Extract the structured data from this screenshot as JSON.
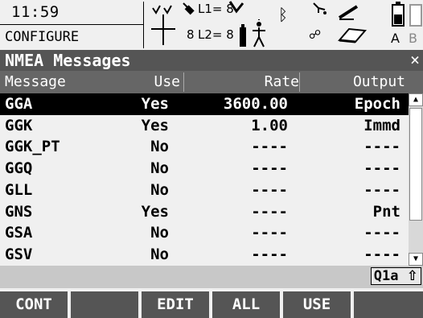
{
  "status": {
    "time": "11:59",
    "mode": "CONFIGURE",
    "l1_label": "L1= 8",
    "l2_label": "L2= 8",
    "sat_count": "8",
    "input_mode_text": "Q1a"
  },
  "title": "NMEA Messages",
  "close_glyph": "×",
  "columns": {
    "message": "Message",
    "use": "Use",
    "rate": "Rate",
    "output": "Output"
  },
  "rows": [
    {
      "message": "GGA",
      "use": "Yes",
      "rate": "3600.00",
      "output": "Epoch",
      "selected": true
    },
    {
      "message": "GGK",
      "use": "Yes",
      "rate": "1.00",
      "output": "Immd"
    },
    {
      "message": "GGK_PT",
      "use": "No",
      "rate": "----",
      "output": "----"
    },
    {
      "message": "GGQ",
      "use": "No",
      "rate": "----",
      "output": "----"
    },
    {
      "message": "GLL",
      "use": "No",
      "rate": "----",
      "output": "----"
    },
    {
      "message": "GNS",
      "use": "Yes",
      "rate": "----",
      "output": "Pnt"
    },
    {
      "message": "GSA",
      "use": "No",
      "rate": "----",
      "output": "----"
    },
    {
      "message": "GSV",
      "use": "No",
      "rate": "----",
      "output": "----"
    }
  ],
  "softkeys": [
    {
      "label": "CONT"
    },
    {
      "label": ""
    },
    {
      "label": "EDIT"
    },
    {
      "label": "ALL"
    },
    {
      "label": "USE"
    },
    {
      "label": ""
    }
  ],
  "colors": {
    "title_bg": "#555555",
    "header_bg": "#666666",
    "selection": "#000000",
    "softkey_bg": "#555555"
  }
}
